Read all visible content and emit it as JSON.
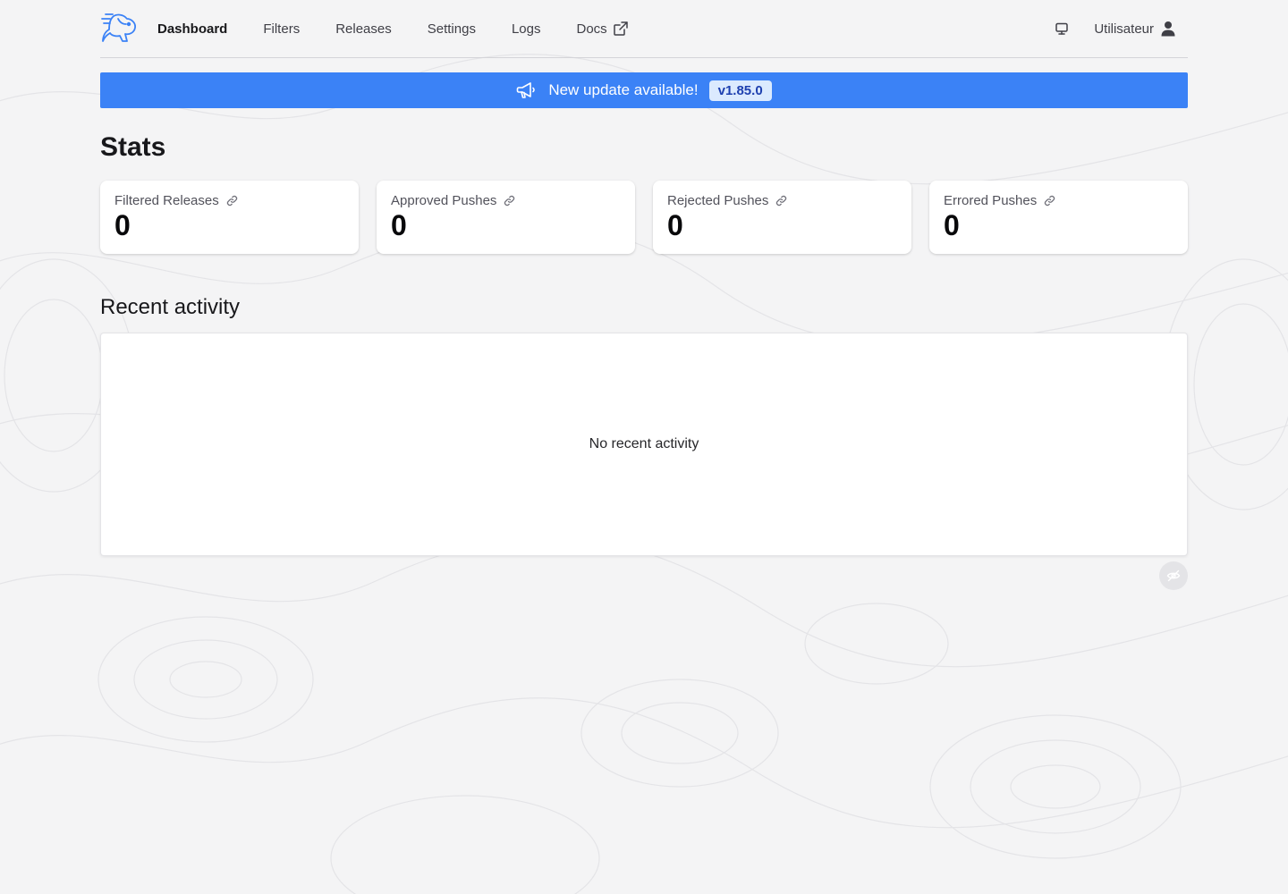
{
  "nav": {
    "items": [
      {
        "label": "Dashboard",
        "active": true
      },
      {
        "label": "Filters"
      },
      {
        "label": "Releases"
      },
      {
        "label": "Settings"
      },
      {
        "label": "Logs"
      },
      {
        "label": "Docs"
      }
    ],
    "user_name": "Utilisateur",
    "icons": [
      "logo-rabbit-icon",
      "external-link-icon",
      "monitor-icon",
      "user-icon"
    ]
  },
  "banner": {
    "text": "New update available!",
    "version": "v1.85.0",
    "icon": "megaphone-icon",
    "color": "#3b82f6"
  },
  "stats": {
    "title": "Stats",
    "cards": [
      {
        "label": "Filtered Releases",
        "value": "0"
      },
      {
        "label": "Approved Pushes",
        "value": "0"
      },
      {
        "label": "Rejected Pushes",
        "value": "0"
      },
      {
        "label": "Errored Pushes",
        "value": "0"
      }
    ]
  },
  "activity": {
    "title": "Recent activity",
    "empty_text": "No recent activity"
  }
}
